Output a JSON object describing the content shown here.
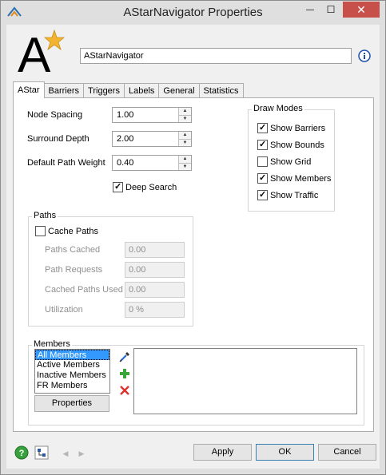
{
  "window": {
    "title": "AStarNavigator  Properties",
    "close_glyph": "✕",
    "minimize_glyph": "—",
    "maximize_glyph": "☐"
  },
  "header": {
    "logo_letter": "A",
    "name_value": "AStarNavigator"
  },
  "tabs": [
    {
      "label": "AStar",
      "active": true
    },
    {
      "label": "Barriers"
    },
    {
      "label": "Triggers"
    },
    {
      "label": "Labels"
    },
    {
      "label": "General"
    },
    {
      "label": "Statistics"
    }
  ],
  "astar": {
    "node_spacing": {
      "label": "Node Spacing",
      "value": "1.00"
    },
    "surround_depth": {
      "label": "Surround Depth",
      "value": "2.00"
    },
    "default_path_weight": {
      "label": "Default Path Weight",
      "value": "0.40"
    },
    "deep_search": {
      "label": "Deep Search",
      "checked": true
    },
    "draw_modes": {
      "title": "Draw Modes",
      "items": [
        {
          "label": "Show Barriers",
          "checked": true
        },
        {
          "label": "Show Bounds",
          "checked": true
        },
        {
          "label": "Show Grid",
          "checked": false
        },
        {
          "label": "Show Members",
          "checked": true
        },
        {
          "label": "Show Traffic",
          "checked": true
        }
      ]
    },
    "paths": {
      "title": "Paths",
      "cache_paths": {
        "label": "Cache Paths",
        "checked": false
      },
      "rows": [
        {
          "label": "Paths Cached",
          "value": "0.00"
        },
        {
          "label": "Path Requests",
          "value": "0.00"
        },
        {
          "label": "Cached Paths Used",
          "value": "0.00"
        },
        {
          "label": "Utilization",
          "value": "0 %"
        }
      ]
    },
    "members": {
      "title": "Members",
      "items": [
        "All Members",
        "Active Members",
        "Inactive Members",
        "FR Members"
      ],
      "selected_index": 0,
      "properties_label": "Properties"
    }
  },
  "footer": {
    "help_glyph": "?",
    "apply_label": "Apply",
    "ok_label": "OK",
    "cancel_label": "Cancel",
    "prev_glyph": "◀",
    "next_glyph": "▶"
  }
}
